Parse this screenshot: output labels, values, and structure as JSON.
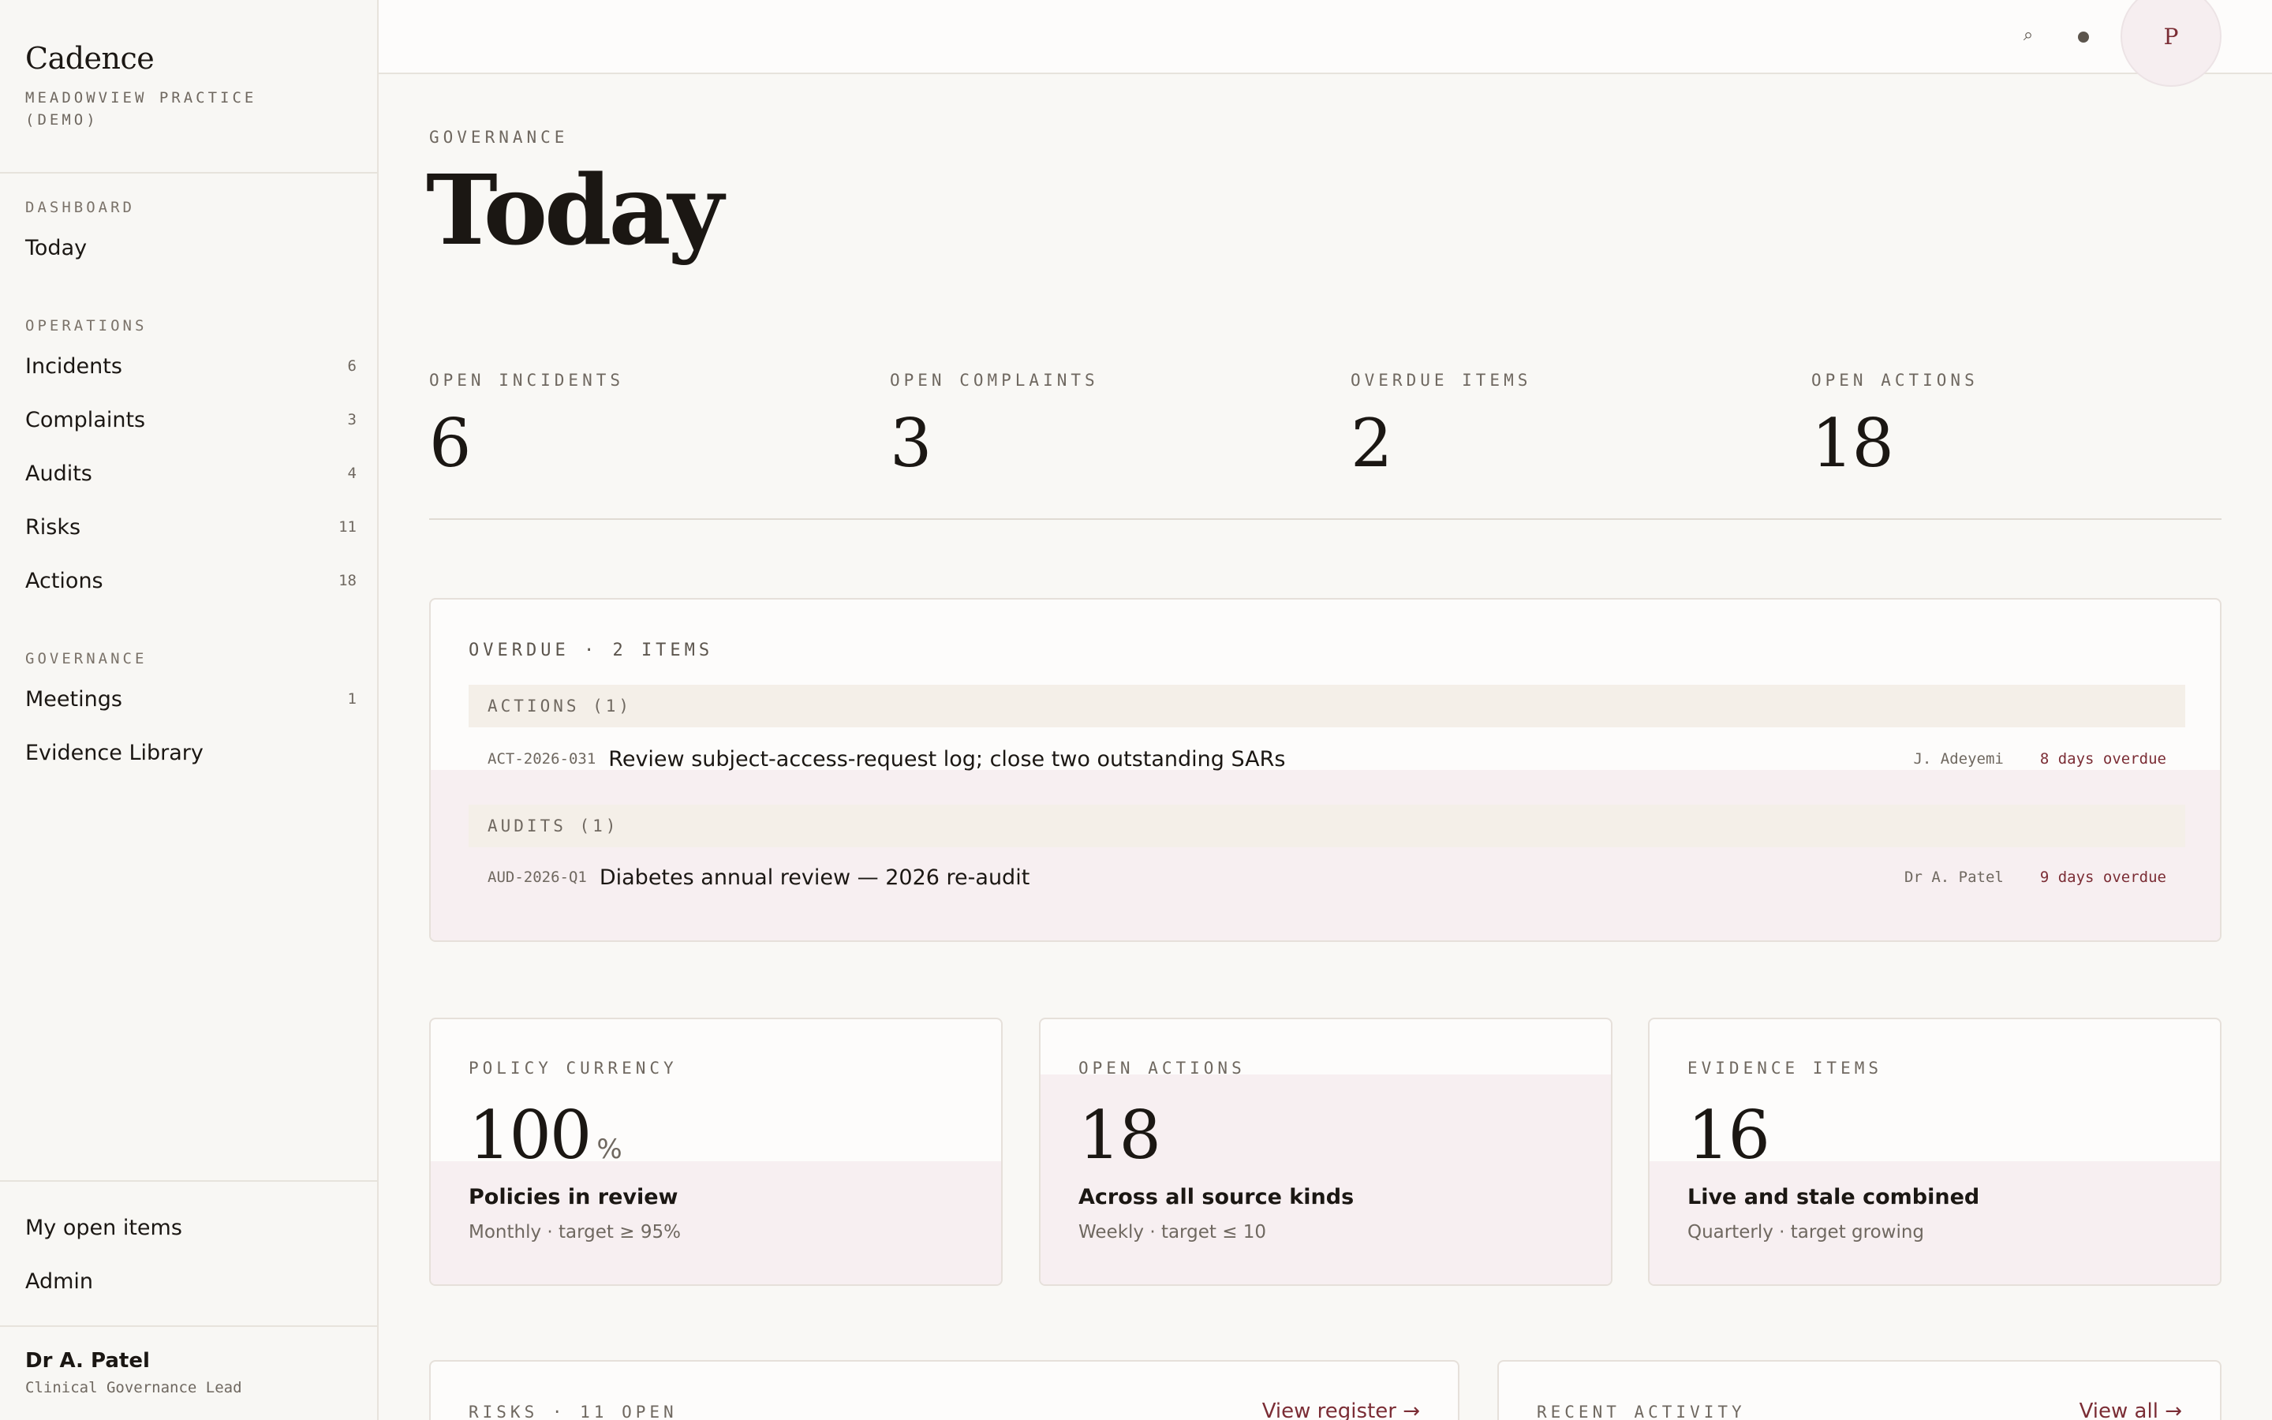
{
  "brand": {
    "name": "Cadence",
    "practice": "Meadowview Practice (demo)"
  },
  "nav": {
    "dashboard": {
      "heading": "Dashboard",
      "items": [
        {
          "label": "Today",
          "count": ""
        }
      ]
    },
    "operations": {
      "heading": "Operations",
      "items": [
        {
          "label": "Incidents",
          "count": "6"
        },
        {
          "label": "Complaints",
          "count": "3"
        },
        {
          "label": "Audits",
          "count": "4"
        },
        {
          "label": "Risks",
          "count": "11"
        },
        {
          "label": "Actions",
          "count": "18"
        }
      ]
    },
    "governance": {
      "heading": "Governance",
      "items": [
        {
          "label": "Meetings",
          "count": "1"
        },
        {
          "label": "Evidence Library",
          "count": ""
        }
      ]
    },
    "footer_items": [
      {
        "label": "My open items"
      },
      {
        "label": "Admin"
      }
    ]
  },
  "user": {
    "name": "Dr A. Patel",
    "role": "Clinical Governance Lead"
  },
  "topbar": {
    "search_icon": "⌕",
    "avatar_initial": "P"
  },
  "page": {
    "eyebrow": "Governance",
    "title": "Today"
  },
  "stats": [
    {
      "label": "Open Incidents",
      "value": "6"
    },
    {
      "label": "Open Complaints",
      "value": "3"
    },
    {
      "label": "Overdue Items",
      "value": "2"
    },
    {
      "label": "Open Actions",
      "value": "18"
    }
  ],
  "overdue": {
    "title": "Overdue · 2 items",
    "groups": [
      {
        "heading": "Actions (1)",
        "items": [
          {
            "id": "ACT-2026-031",
            "title": "Review subject-access-request log; close two outstanding SARs",
            "owner": "J. Adeyemi",
            "status": "8 days overdue"
          }
        ]
      },
      {
        "heading": "Audits (1)",
        "items": [
          {
            "id": "AUD-2026-Q1",
            "title": "Diabetes annual review — 2026 re-audit",
            "owner": "Dr A. Patel",
            "status": "9 days overdue"
          }
        ]
      }
    ]
  },
  "metrics": [
    {
      "label": "Policy Currency",
      "value": "100",
      "unit": "%",
      "caption": "Policies in review",
      "sub": "Monthly · target ≥ 95%"
    },
    {
      "label": "Open Actions",
      "value": "18",
      "unit": "",
      "caption": "Across all source kinds",
      "sub": "Weekly · target ≤ 10"
    },
    {
      "label": "Evidence Items",
      "value": "16",
      "unit": "",
      "caption": "Live and stale combined",
      "sub": "Quarterly · target growing"
    }
  ],
  "bottom_cards": [
    {
      "title": "Risks · 11 open",
      "link": "View register →"
    },
    {
      "title": "Recent activity",
      "link": "View all →"
    }
  ],
  "colors": {
    "accent": "#7b2d35",
    "tint": "#f7eff1",
    "background": "#f9f8f5"
  }
}
